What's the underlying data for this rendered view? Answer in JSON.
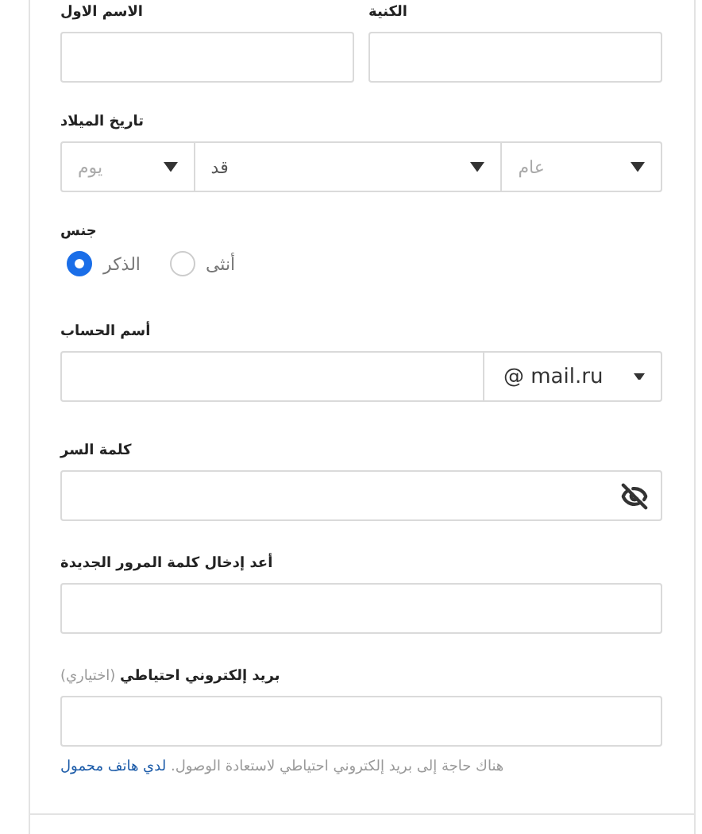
{
  "name_fields": [
    {
      "label": "الكنية"
    },
    {
      "label": "الاسم الاول"
    }
  ],
  "birth_date": {
    "label": "تاريخ الميلاد",
    "selects": [
      {
        "text": "عام",
        "kind": "placeholder"
      },
      {
        "text": "قد",
        "kind": "value"
      },
      {
        "text": "يوم",
        "kind": "placeholder"
      }
    ]
  },
  "gender": {
    "label": "جنس",
    "options": [
      {
        "label": "أنثى",
        "selected": false
      },
      {
        "label": "الذكر",
        "selected": true
      }
    ]
  },
  "account": {
    "label": "أسم الحساب",
    "domain": "@ mail.ru"
  },
  "password": {
    "label": "كلمة السر"
  },
  "repeat_password": {
    "label": "أعد إدخال كلمة المرور الجديدة"
  },
  "backup_email": {
    "label": "**بريد إلكتروني احتياطي** (اختياري)",
    "hint": "هناك حاجة إلى بريد إلكتروني احتياطي لاستعادة الوصول.",
    "hint_link": "لدي هاتف محمول"
  }
}
